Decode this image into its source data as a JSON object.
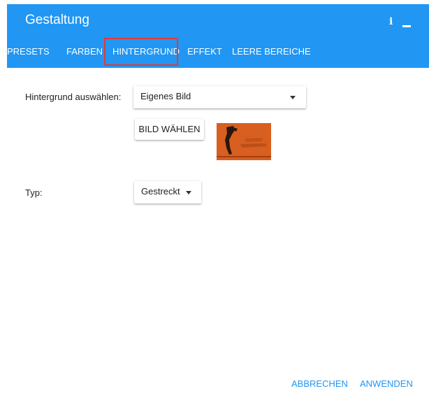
{
  "window": {
    "title": "Gestaltung",
    "info_icon": "info-icon",
    "minimize_icon": "minimize-icon",
    "header_color": "#2196f3"
  },
  "tabs": [
    {
      "label": "PRESETS"
    },
    {
      "label": "FARBEN"
    },
    {
      "label": "HINTERGRUND",
      "selected": true
    },
    {
      "label": "EFFEKT"
    },
    {
      "label": "LEERE BEREICHE"
    }
  ],
  "background": {
    "label": "Hintergrund auswählen:",
    "selected": "Eigenes Bild",
    "choose_button": "BILD WÄHLEN",
    "thumbnail_color": "#d85f1f"
  },
  "type": {
    "label": "Typ:",
    "selected": "Gestreckt"
  },
  "footer": {
    "cancel": "ABBRECHEN",
    "apply": "ANWENDEN",
    "accent_color": "#2196f3"
  }
}
